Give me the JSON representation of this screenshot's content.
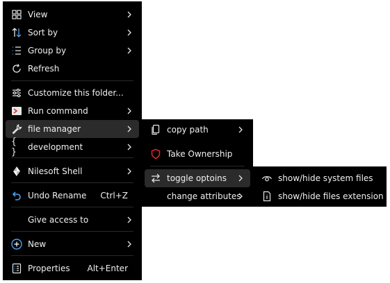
{
  "main_menu": {
    "items": [
      {
        "label": "View",
        "icon": "grid-icon"
      },
      {
        "label": "Sort by",
        "icon": "sort-icon"
      },
      {
        "label": "Group by",
        "icon": "group-list-icon"
      },
      {
        "label": "Refresh",
        "icon": "refresh-icon"
      },
      {
        "label": "Customize this folder...",
        "icon": "sliders-icon"
      },
      {
        "label": "Run command",
        "icon": "terminal-icon"
      },
      {
        "label": "file manager",
        "icon": "wrench-icon"
      },
      {
        "label": "development",
        "icon": "braces-icon"
      },
      {
        "label": "Nilesoft Shell",
        "icon": "nilesoft-logo-icon"
      },
      {
        "label": "Undo Rename",
        "icon": "undo-icon",
        "shortcut": "Ctrl+Z"
      },
      {
        "label": "Give access to"
      },
      {
        "label": "New",
        "icon": "plus-circle-icon"
      },
      {
        "label": "Properties",
        "icon": "properties-icon",
        "shortcut": "Alt+Enter"
      }
    ]
  },
  "file_manager_menu": {
    "items": [
      {
        "label": "copy path",
        "icon": "copy-icon"
      },
      {
        "label": "Take Ownership",
        "icon": "shield-icon"
      },
      {
        "label": "toggle optoins",
        "icon": "swap-arrows-icon"
      },
      {
        "label": "change attributes"
      }
    ]
  },
  "toggle_menu": {
    "items": [
      {
        "label": "show/hide system files",
        "icon": "eye-icon"
      },
      {
        "label": "show/hide files extension",
        "icon": "file-info-icon"
      }
    ]
  },
  "colors": {
    "menu_bg": "#000000",
    "highlight": "#2b2b2b",
    "text": "#f0f0f0",
    "accent_blue": "#4aa3f0",
    "shield_red": "#e0242b"
  }
}
